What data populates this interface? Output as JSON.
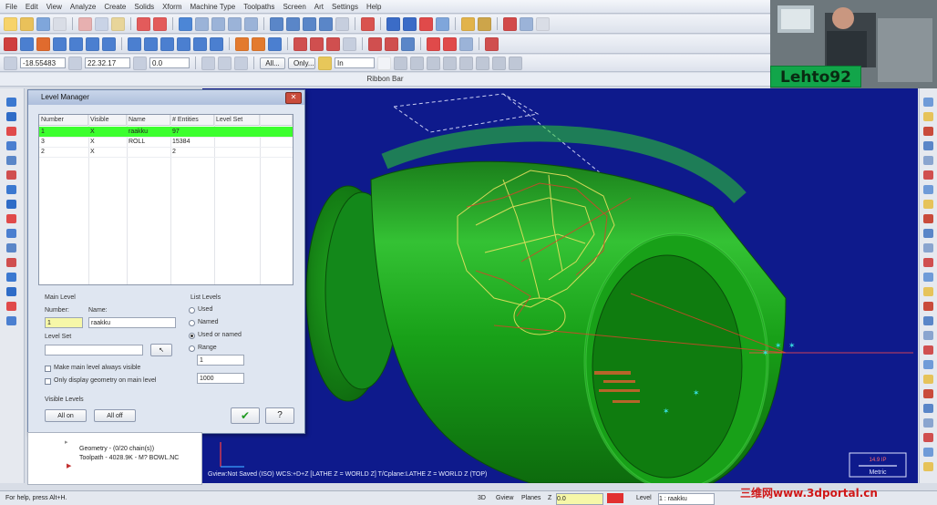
{
  "menu": [
    "File",
    "Edit",
    "View",
    "Analyze",
    "Create",
    "Solids",
    "Xform",
    "Machine Type",
    "Toolpaths",
    "Screen",
    "Art",
    "Settings",
    "Help"
  ],
  "fields": {
    "x_value": "-18.55483",
    "y_value": "22.32.17",
    "z_value": "0.0",
    "all_label": "All...",
    "only_label": "Only...",
    "unit_value": "In"
  },
  "ribbon_label": "Ribbon Bar",
  "webcam": {
    "name": "Lehto92"
  },
  "dialog": {
    "title": "Level Manager",
    "columns": [
      "Number",
      "Visible",
      "Name",
      "# Entities",
      "Level Set"
    ],
    "rows": [
      {
        "number": "1",
        "visible": "X",
        "name": "raakku",
        "entities": "97",
        "set": "",
        "active": true
      },
      {
        "number": "3",
        "visible": "X",
        "name": "ROLL",
        "entities": "15384",
        "set": "",
        "active": false
      },
      {
        "number": "2",
        "visible": "X",
        "name": "",
        "entities": "2",
        "set": "",
        "active": false
      }
    ],
    "main_level": {
      "heading": "Main Level",
      "number_label": "Number:",
      "name_label": "Name:",
      "number_value": "1",
      "name_value": "raakku",
      "level_set_label": "Level Set",
      "cb_visible": "Make main level always visible",
      "cb_only": "Only display geometry on main level"
    },
    "list_levels": {
      "heading": "List Levels",
      "options": [
        "Used",
        "Named",
        "Used or named",
        "Range"
      ],
      "selected": 2,
      "range_from": "1",
      "range_to": "1000"
    },
    "visible_levels": {
      "heading": "Visible Levels",
      "all_on": "All on",
      "all_off": "All off"
    }
  },
  "tree": {
    "items": [
      "Geometry - (0/20 chain(s))",
      "Toolpath - 4028.9K - M? BOWL.NC"
    ]
  },
  "viewport": {
    "status": "Gview:Not Saved (ISO)   WCS:+D+Z [LATHE Z = WORLD Z]   T/Cplane:LATHE Z = WORLD Z (TOP)",
    "scale_value": "14.9 IP",
    "scale_unit": "Metric"
  },
  "statusbar": {
    "help": "For help, press Alt+H.",
    "mode": "3D",
    "gview": "Gview",
    "planes": "Planes",
    "z_label": "Z",
    "z_value": "0.0",
    "level_label": "Level",
    "level_value": "1 : raakku"
  },
  "watermark": "三维网www.3dportal.cn",
  "colors": {
    "viewport_bg": "#0e1a8c",
    "part": "#1e9b1e",
    "active_row": "#3cff2e"
  }
}
